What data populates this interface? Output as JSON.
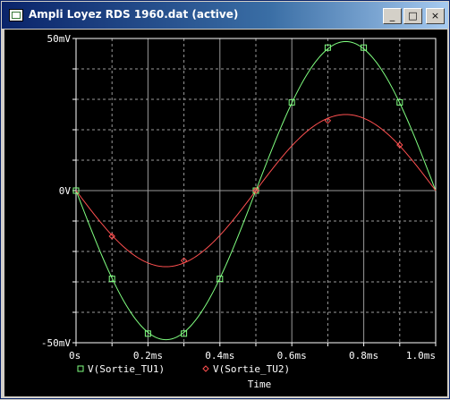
{
  "window": {
    "title": "Ampli Loyez RDS 1960.dat (active)",
    "controls": {
      "minimize": "_",
      "maximize": "□",
      "close": "×"
    }
  },
  "chart_data": {
    "type": "line",
    "xlabel": "Time",
    "ylabel": "",
    "x_ticks": [
      "0s",
      "0.2ms",
      "0.4ms",
      "0.6ms",
      "0.8ms",
      "1.0ms"
    ],
    "x_tick_values": [
      0,
      0.2,
      0.4,
      0.6,
      0.8,
      1.0
    ],
    "y_ticks": [
      "-50mV",
      "0V",
      "50mV"
    ],
    "y_tick_values": [
      -50,
      0,
      50
    ],
    "xlim": [
      0,
      1.0
    ],
    "ylim": [
      -50,
      50
    ],
    "grid": true,
    "background": "#000000",
    "series": [
      {
        "name": "V(Sortie_TU1)",
        "color": "#80ff80",
        "marker": "square",
        "x": [
          0,
          0.05,
          0.1,
          0.15,
          0.2,
          0.25,
          0.3,
          0.35,
          0.4,
          0.45,
          0.5,
          0.55,
          0.6,
          0.65,
          0.7,
          0.75,
          0.8,
          0.85,
          0.9,
          0.95,
          1.0
        ],
        "values": [
          0,
          -15,
          -29,
          -40,
          -47,
          -49,
          -47,
          -40,
          -29,
          -15,
          0,
          15,
          29,
          40,
          47,
          49,
          47,
          40,
          29,
          15,
          0
        ]
      },
      {
        "name": "V(Sortie_TU2)",
        "color": "#ff5050",
        "marker": "diamond",
        "x": [
          0,
          0.05,
          0.1,
          0.15,
          0.2,
          0.25,
          0.3,
          0.35,
          0.4,
          0.45,
          0.5,
          0.55,
          0.6,
          0.65,
          0.7,
          0.75,
          0.8,
          0.85,
          0.9,
          0.95,
          1.0
        ],
        "values": [
          0,
          -8,
          -15,
          -20,
          -23,
          -25,
          -23,
          -20,
          -15,
          -8,
          0,
          8,
          15,
          20,
          23,
          25,
          23,
          20,
          15,
          8,
          0
        ]
      }
    ]
  }
}
